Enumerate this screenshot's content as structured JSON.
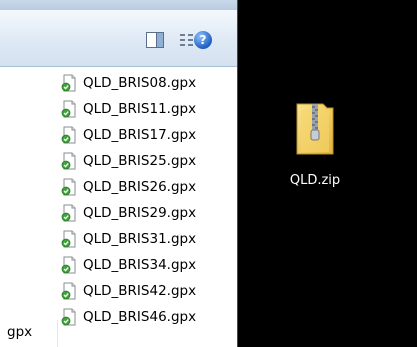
{
  "toolbar": {
    "views_icon": "views-grid-icon",
    "dropdown_icon": "chevron-down-icon",
    "preview_icon": "preview-pane-icon",
    "help_icon": "help-icon",
    "help_glyph": "?"
  },
  "files": [
    {
      "name": "QLD_BRIS08.gpx"
    },
    {
      "name": "QLD_BRIS11.gpx"
    },
    {
      "name": "QLD_BRIS17.gpx"
    },
    {
      "name": "QLD_BRIS25.gpx"
    },
    {
      "name": "QLD_BRIS26.gpx"
    },
    {
      "name": "QLD_BRIS29.gpx"
    },
    {
      "name": "QLD_BRIS31.gpx"
    },
    {
      "name": "QLD_BRIS34.gpx"
    },
    {
      "name": "QLD_BRIS42.gpx"
    },
    {
      "name": "QLD_BRIS46.gpx"
    }
  ],
  "partial_column_text": "gpx",
  "desktop": {
    "zip_label": "QLD.zip",
    "zip_icon": "zip-folder-icon"
  },
  "colors": {
    "desktop_bg": "#000000",
    "toolbar_top": "#f3f8fd",
    "toolbar_bottom": "#d4e1ef",
    "folder_yellow": "#f5d66b",
    "zipper_gray": "#9aa3ad"
  }
}
